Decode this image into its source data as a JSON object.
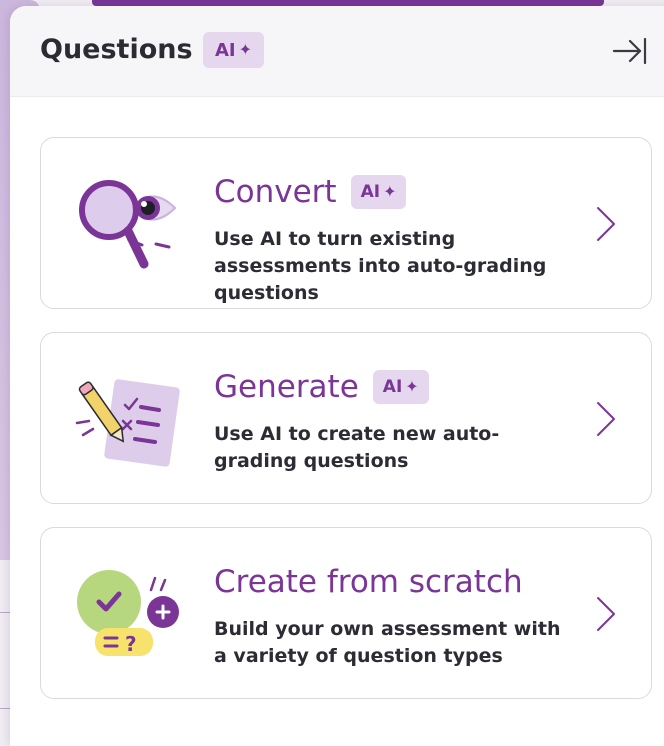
{
  "panel": {
    "title": "Questions",
    "badge": "AI",
    "collapse_icon": "collapse-right-icon"
  },
  "cards": [
    {
      "title": "Convert",
      "badge": "AI",
      "description": "Use AI to turn existing assessments into auto-grading questions",
      "illustration": "magnifier-eye-icon"
    },
    {
      "title": "Generate",
      "badge": "AI",
      "description": "Use AI to create new auto-grading questions",
      "illustration": "pencil-checklist-icon"
    },
    {
      "title": "Create from scratch",
      "description": "Build your own assessment with a variety of question types",
      "illustration": "speech-bubbles-icon"
    }
  ],
  "colors": {
    "accent": "#7a3596",
    "badge_bg": "#e4d7ee",
    "text": "#2c2c34"
  }
}
